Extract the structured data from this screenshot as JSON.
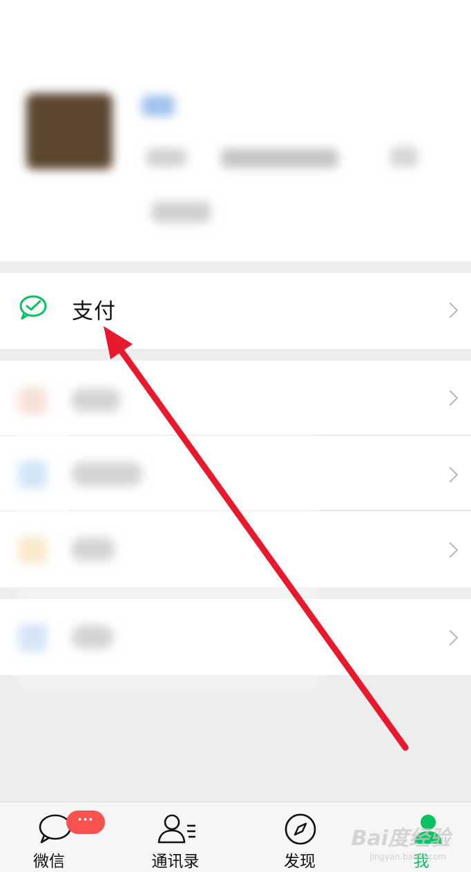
{
  "menu": {
    "pay_label": "支付"
  },
  "tabbar": {
    "chats_label": "微信",
    "contacts_label": "通讯录",
    "discover_label": "发现",
    "me_label": "我",
    "chats_badge": "···"
  },
  "watermark": {
    "text": "Bai度经验",
    "sub": "jingyan.baidu.com"
  },
  "colors": {
    "accent": "#07c160",
    "badge": "#fa5151",
    "arrow": "#e8192c",
    "background": "#ededed"
  },
  "icons": {
    "pay": "wechat-pay-icon",
    "chats": "chat-bubble-icon",
    "contacts": "contacts-icon",
    "discover": "compass-icon",
    "me": "person-icon",
    "row": "chevron-right-icon"
  }
}
